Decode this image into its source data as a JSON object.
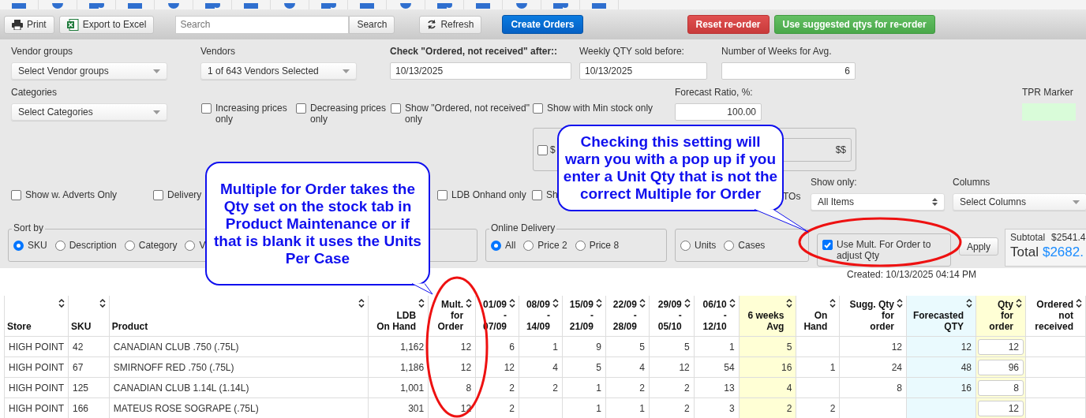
{
  "toolbar": {
    "print": "Print",
    "export": "Export to Excel",
    "search": {
      "placeholder": "Search",
      "button": "Search"
    },
    "refresh": "Refresh",
    "create": "Create Orders",
    "reset": "Reset re-order",
    "suggest": "Use suggested qtys for re-order"
  },
  "filters": {
    "vendor_groups": {
      "label": "Vendor groups",
      "value": "Select Vendor groups"
    },
    "vendors": {
      "label": "Vendors",
      "value": "1 of 643 Vendors Selected"
    },
    "ordered_after": {
      "label": "Check \"Ordered, not received\" after::",
      "value": "10/13/2025"
    },
    "weekly_before": {
      "label": "Weekly QTY sold before:",
      "value": "10/13/2025"
    },
    "weeks_avg": {
      "label": "Number of Weeks for Avg.",
      "value": "6"
    },
    "categories": {
      "label": "Categories",
      "value": "Select Categories"
    },
    "checks_row1": [
      {
        "label": "Increasing prices only",
        "checked": false
      },
      {
        "label": "Decreasing prices only",
        "checked": false
      },
      {
        "label": "Show \"Ordered, not received\" only",
        "checked": false
      },
      {
        "label": "Show with Min stock only",
        "checked": false
      }
    ],
    "forecast_ratio": {
      "label": "Forecast Ratio, %:",
      "value": "100.00"
    },
    "tpr_marker": {
      "label": "TPR Marker"
    },
    "price_box": {
      "label": "$",
      "checked": false,
      "suffix": "$$"
    },
    "checks_row3": [
      {
        "label": "Show w. Adverts Only",
        "checked": false
      },
      {
        "label": "Delivery",
        "checked": false
      },
      {
        "label": "LDB Onhand only",
        "checked": false
      },
      {
        "label": "Sh",
        "checked": false
      }
    ],
    "tos": "TOs",
    "show_only": {
      "label": "Show only:",
      "value": "All Items"
    },
    "columns": {
      "label": "Columns",
      "value": "Select Columns"
    },
    "sort_by": {
      "legend": "Sort by",
      "options": [
        {
          "label": "SKU",
          "selected": true
        },
        {
          "label": "Description",
          "selected": false
        },
        {
          "label": "Category",
          "selected": false
        },
        {
          "label": "V",
          "selected": false
        }
      ]
    },
    "online_delivery": {
      "legend": "Online Delivery",
      "options": [
        {
          "label": "All",
          "selected": true
        },
        {
          "label": "Price 2",
          "selected": false
        },
        {
          "label": "Price 8",
          "selected": false
        }
      ]
    },
    "units": {
      "options": [
        {
          "label": "Units",
          "selected": false
        },
        {
          "label": "Cases",
          "selected": false
        }
      ]
    },
    "mult_order": {
      "label": "Use Mult. For Order to adjust Qty",
      "checked": true
    },
    "apply": "Apply",
    "totals": {
      "subtotal_label": "Subtotal",
      "subtotal": "$2541.4",
      "total_label": "Total",
      "total": "$2682."
    }
  },
  "created": "Created: 10/13/2025 04:14 PM",
  "table": {
    "columns": [
      {
        "lines": [
          "Store"
        ],
        "kind": "text"
      },
      {
        "lines": [
          "SKU"
        ],
        "kind": "text"
      },
      {
        "lines": [
          "Product"
        ],
        "kind": "text"
      },
      {
        "lines": [
          "LDB",
          "On Hand"
        ],
        "kind": "text"
      },
      {
        "lines": [
          "Mult.",
          "for",
          "Order"
        ],
        "kind": "text"
      },
      {
        "lines": [
          "01/09",
          "-",
          "07/09"
        ],
        "kind": "text"
      },
      {
        "lines": [
          "08/09",
          "-",
          "14/09"
        ],
        "kind": "text"
      },
      {
        "lines": [
          "15/09",
          "-",
          "21/09"
        ],
        "kind": "text"
      },
      {
        "lines": [
          "22/09",
          "-",
          "28/09"
        ],
        "kind": "text"
      },
      {
        "lines": [
          "29/09",
          "-",
          "05/10"
        ],
        "kind": "text"
      },
      {
        "lines": [
          "06/10",
          "-",
          "12/10"
        ],
        "kind": "text"
      },
      {
        "lines": [
          "6 weeks",
          "Avg"
        ],
        "kind": "text"
      },
      {
        "lines": [
          "On",
          "Hand"
        ],
        "kind": "text"
      },
      {
        "lines": [
          "Sugg. Qty",
          "for",
          "order"
        ],
        "kind": "text"
      },
      {
        "lines": [
          "Forecasted",
          "QTY"
        ],
        "kind": "text"
      },
      {
        "lines": [
          "Qty",
          "for",
          "order"
        ],
        "kind": "input"
      },
      {
        "lines": [
          "Ordered",
          "not",
          "received"
        ],
        "kind": "text"
      }
    ],
    "rows": [
      [
        "HIGH POINT",
        "42",
        "CANADIAN CLUB .750 (.75L)",
        "1,162",
        "12",
        "6",
        "1",
        "9",
        "5",
        "5",
        "1",
        "5",
        null,
        "12",
        "12",
        "12",
        null
      ],
      [
        "HIGH POINT",
        "67",
        "SMIRNOFF RED .750 (.75L)",
        "1,186",
        "12",
        "12",
        "4",
        "5",
        "4",
        "12",
        "54",
        "16",
        "1",
        "24",
        "48",
        "96",
        null
      ],
      [
        "HIGH POINT",
        "125",
        "CANADIAN CLUB 1.14L (1.14L)",
        "1,001",
        "8",
        "2",
        "2",
        "1",
        "2",
        "2",
        "13",
        "4",
        null,
        "8",
        "16",
        "8",
        null
      ],
      [
        "HIGH POINT",
        "166",
        "MATEUS ROSE SOGRAPE (.75L)",
        "301",
        "12",
        "2",
        null,
        "1",
        "1",
        "2",
        "3",
        "2",
        "2",
        null,
        null,
        "12",
        null
      ]
    ]
  },
  "callouts": [
    {
      "text": "Multiple for Order takes the Qty set on the stock tab in Product Maintenance or if that is blank it uses the Units Per Case"
    },
    {
      "text": "Checking this setting will warn you with a pop up if you enter a Unit Qty that is not the correct Multiple for Order"
    }
  ]
}
